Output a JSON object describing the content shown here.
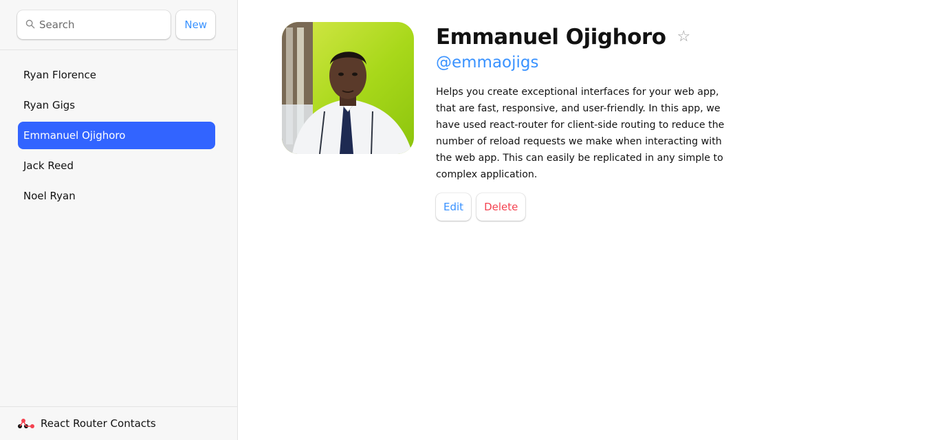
{
  "sidebar": {
    "search": {
      "placeholder": "Search",
      "value": ""
    },
    "new_label": "New",
    "contacts": [
      {
        "label": "Ryan Florence",
        "active": false
      },
      {
        "label": "Ryan Gigs",
        "active": false
      },
      {
        "label": "Emmanuel Ojighoro",
        "active": true
      },
      {
        "label": "Jack Reed",
        "active": false
      },
      {
        "label": "Noel Ryan",
        "active": false
      }
    ],
    "footer": {
      "label": "React Router Contacts",
      "icon": "react-router-logo-icon"
    }
  },
  "contact": {
    "name": "Emmanuel Ojighoro",
    "favorite_symbol": "☆",
    "handle": "@emmaojigs",
    "bio": "Helps you create exceptional interfaces for your web app, that are fast, responsive, and user-friendly. In this app, we have used react-router for client-side routing to reduce the number of reload requests we make when interacting with the web app. This can easily be replicated in any simple to complex application.",
    "edit_label": "Edit",
    "delete_label": "Delete"
  },
  "colors": {
    "accent": "#3992ff",
    "active_bg": "#3264ff",
    "danger": "#f44250",
    "sidebar_bg": "#f7f7f7"
  }
}
